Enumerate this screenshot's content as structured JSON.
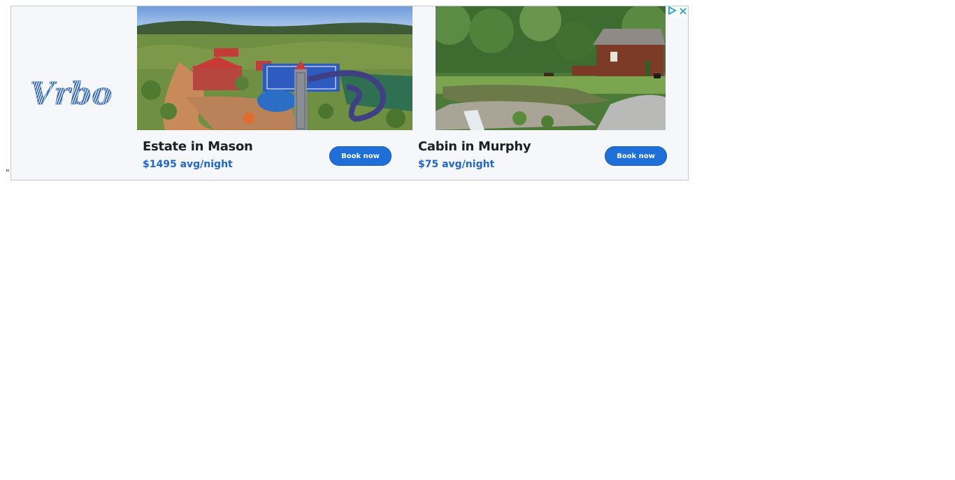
{
  "page": {
    "stray_text": "\""
  },
  "ad": {
    "brand": "Vrbo",
    "brand_color": "#245abc",
    "accent_color": "#1f6fd8",
    "price_color": "#1e66d0",
    "cards": [
      {
        "title": "Estate in Mason",
        "price": "$1495 avg/night",
        "button": "Book now"
      },
      {
        "title": "Cabin in Murphy",
        "price": "$75 avg/night",
        "button": "Book now"
      }
    ],
    "icons": [
      "adchoices-icon",
      "close-icon"
    ]
  }
}
